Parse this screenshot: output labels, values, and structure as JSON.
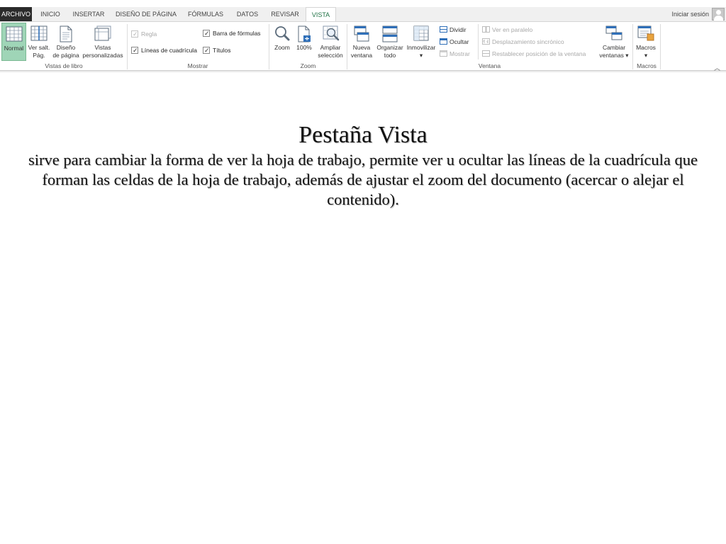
{
  "tabs": [
    {
      "label": "ARCHIVO"
    },
    {
      "label": "INICIO"
    },
    {
      "label": "INSERTAR"
    },
    {
      "label": "DISEÑO DE PÁGINA"
    },
    {
      "label": "FÓRMULAS"
    },
    {
      "label": "DATOS"
    },
    {
      "label": "REVISAR"
    },
    {
      "label": "VISTA"
    }
  ],
  "active_tab": "VISTA",
  "signin": "Iniciar sesión",
  "colors": {
    "accent": "#217346",
    "selected_button": "#9fd5b7",
    "file_tab": "#2b2b2b"
  },
  "ribbon": {
    "vistas_libro": {
      "label": "Vistas de libro",
      "normal": "Normal",
      "ver_salt": "Ver salt.\nPág.",
      "diseno": "Diseño\nde página",
      "vistas_pers": "Vistas\npersonalizadas"
    },
    "mostrar": {
      "label": "Mostrar",
      "regla": "Regla",
      "lineas": "Líneas de cuadrícula",
      "barra": "Barra de fórmulas",
      "titulos": "Títulos"
    },
    "zoom": {
      "label": "Zoom",
      "zoom": "Zoom",
      "cien": "100%",
      "ampliar": "Ampliar\nselección"
    },
    "ventana": {
      "label": "Ventana",
      "nueva": "Nueva\nventana",
      "organizar": "Organizar\ntodo",
      "inmovilizar": "Inmovilizar\n▾",
      "dividir": "Dividir",
      "ocultar": "Ocultar",
      "mostrar": "Mostrar",
      "ver_paralelo": "Ver en paralelo",
      "desplazamiento": "Desplazamiento sincrónico",
      "restablecer": "Restablecer posición de la ventana",
      "cambiar": "Cambiar\nventanas ▾"
    },
    "macros": {
      "label": "Macros",
      "macros": "Macros\n▾"
    }
  },
  "content": {
    "title": "Pestaña Vista",
    "description": "sirve para cambiar la forma de ver la hoja de trabajo, permite ver u ocultar las líneas de la cuadrícula que forman las celdas de la hoja de trabajo, además de ajustar el zoom del documento (acercar o alejar el contenido)."
  }
}
